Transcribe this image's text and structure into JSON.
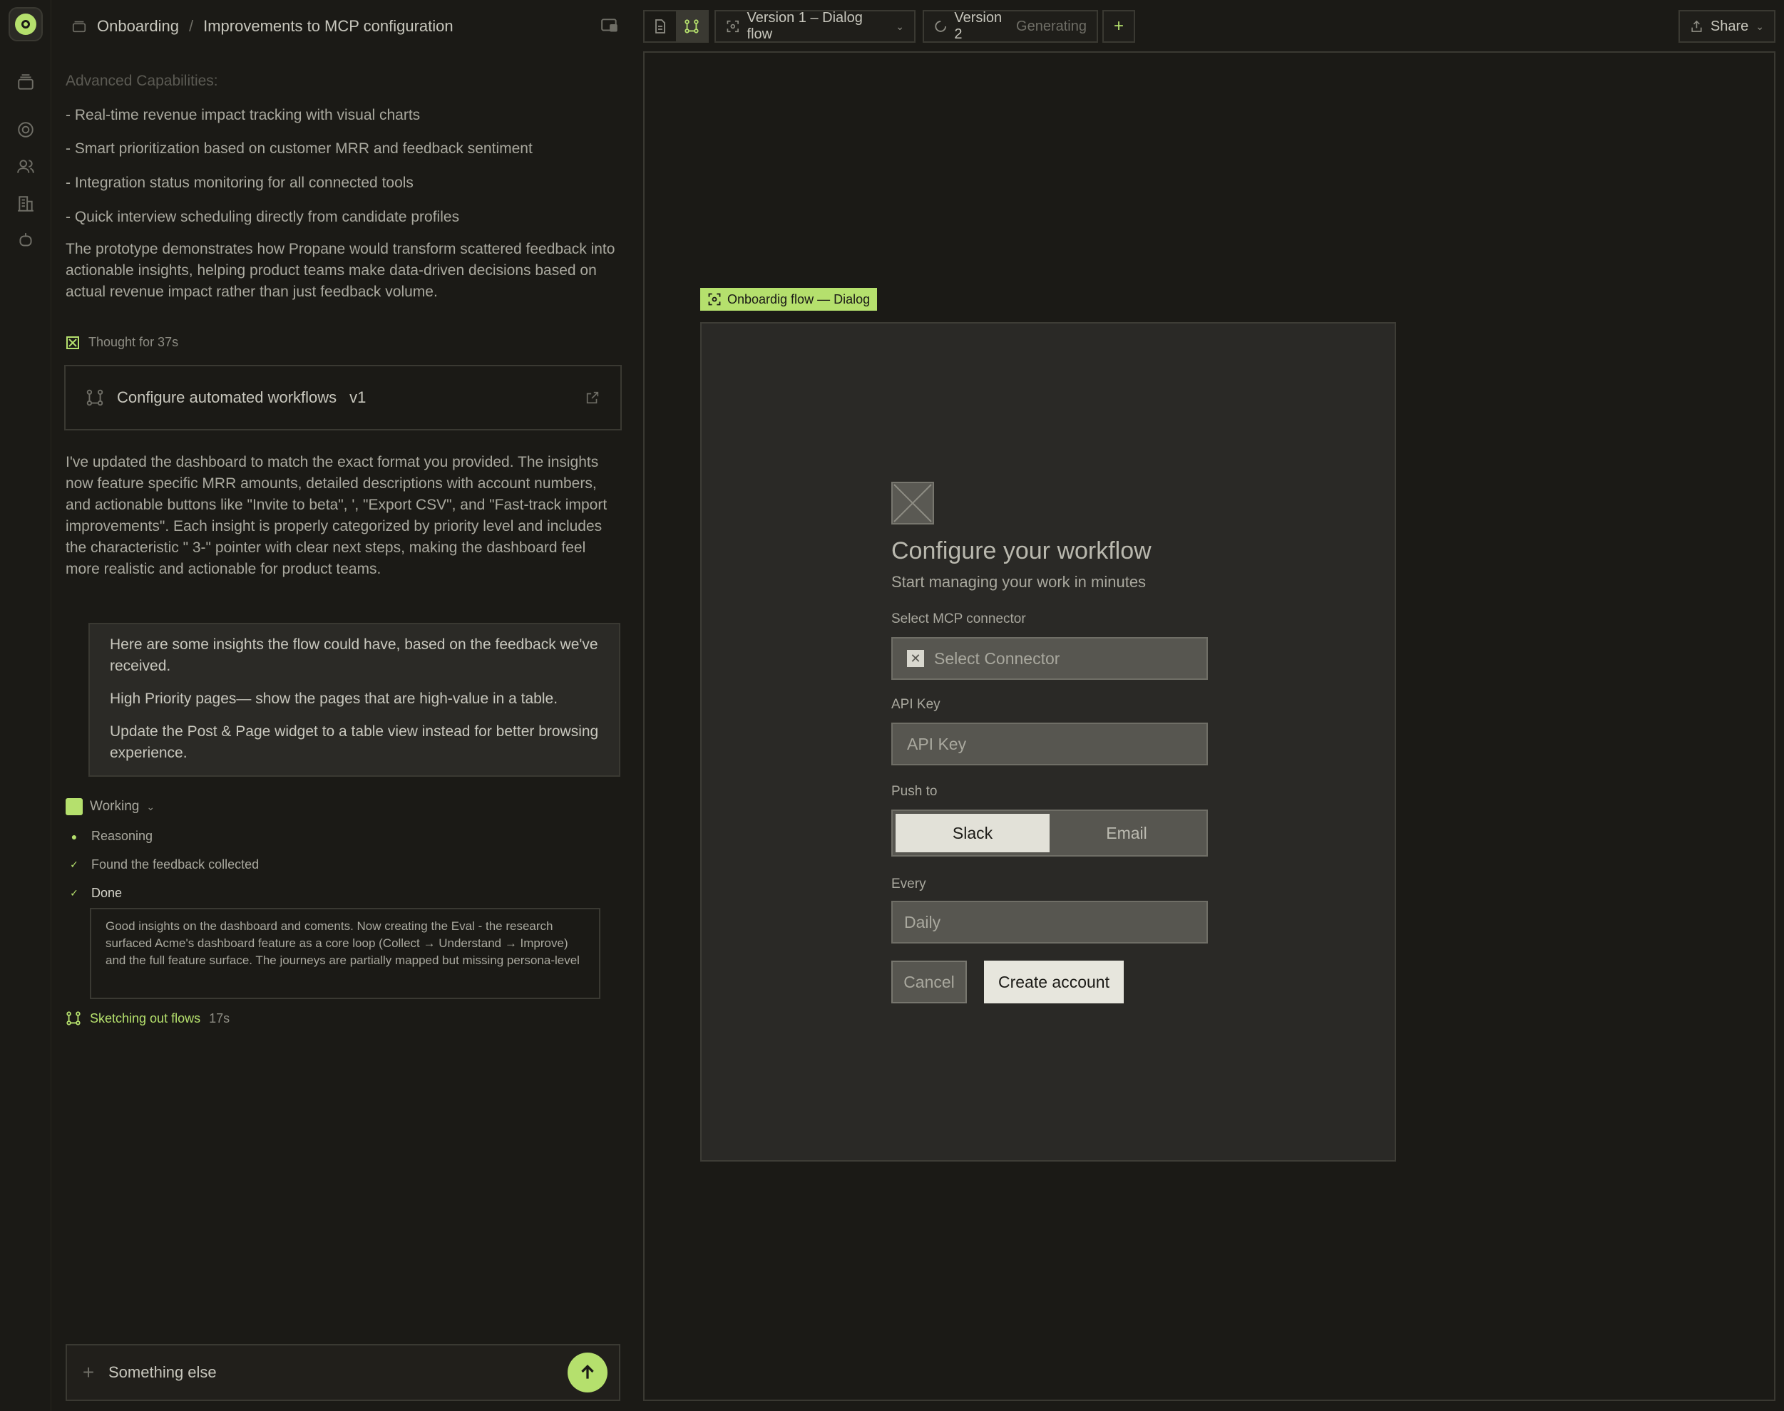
{
  "breadcrumb": {
    "parent": "Onboarding",
    "separator": "/",
    "current": "Improvements to MCP configuration"
  },
  "chat": {
    "faded_heading": "Advanced Capabilities:",
    "bullets": [
      "- Real-time revenue impact tracking with visual charts",
      "- Smart prioritization based on customer MRR and feedback sentiment",
      "- Integration status monitoring for all connected tools",
      "- Quick interview scheduling directly from candidate profiles"
    ],
    "summary": "The prototype demonstrates how Propane would transform scattered feedback into actionable insights, helping product teams make data-driven decisions based on actual revenue impact rather than just feedback volume.",
    "thought": "Thought for 37s",
    "artifact_title": "Configure automated workflows",
    "artifact_version": "v1",
    "update_message": "I've updated the dashboard to match the exact format you provided. The insights now feature specific MRR amounts, detailed descriptions with account numbers, and actionable buttons like \"Invite to beta\", ', \"Export CSV\", and \"Fast-track import improvements\". Each insight is properly categorized by priority level and includes the characteristic \" 3-\" pointer with clear next steps, making the dashboard feel more realistic and actionable for product teams.",
    "quote": [
      "Here are some insights the flow could have, based on the feedback we've received.",
      "High Priority pages— show the pages that are high-value in a table.",
      "Update the Post & Page widget to a table view instead for better browsing experience."
    ],
    "working_label": "Working",
    "steps": [
      "Reasoning",
      "Found the feedback collected",
      "Done"
    ],
    "done_detail": "Good insights on the dashboard and coments. Now creating the Eval - the research surfaced Acme's dashboard feature as a core loop (Collect → Understand → Improve) and the full feature surface. The journeys are partially mapped but missing persona-level",
    "sketch_label": "Sketching out flows",
    "sketch_time": "17s",
    "composer_placeholder": "Something else"
  },
  "toolbar": {
    "version1": "Version 1 – Dialog flow",
    "version2": "Version 2",
    "version2_status": "Generating",
    "add": "+",
    "share": "Share"
  },
  "frame_tag": "Onboardig flow — Dialog",
  "dialog": {
    "title": "Configure your workflow",
    "subtitle": "Start managing your work in minutes",
    "connector_label": "Select MCP connector",
    "connector_value": "Select Connector",
    "api_label": "API Key",
    "api_placeholder": "API Key",
    "push_label": "Push to",
    "push_options": [
      "Slack",
      "Email"
    ],
    "every_label": "Every",
    "every_value": "Daily",
    "cancel": "Cancel",
    "create": "Create account"
  },
  "colors": {
    "accent": "#b5e06d",
    "background": "#1b1a16",
    "frame": "#2a2926"
  }
}
